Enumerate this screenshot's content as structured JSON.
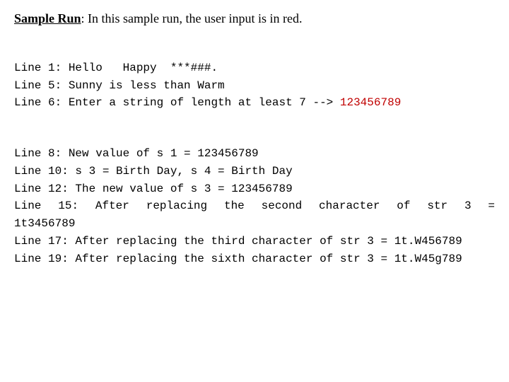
{
  "heading": {
    "label": "Sample Run",
    "rest": ": In this sample run, the user input is in red."
  },
  "lines": {
    "l1": "Line 1: Hello   Happy  ***###.",
    "l5": "Line 5: Sunny is less than Warm",
    "l6a": "Line 6: Enter a string of length at least 7 --> ",
    "l6b": "123456789",
    "l8": "Line 8: New value of s 1 = 123456789",
    "l10": "Line 10: s 3 = Birth Day, s 4 = Birth Day",
    "l12": "Line 12: The new value of s 3 = 123456789",
    "l15": "Line 15: After replacing the second character of str 3 = 1t3456789",
    "l15_words": [
      "Line",
      "15:",
      "After",
      "replacing",
      "the",
      "second",
      "character",
      "of",
      "str 3",
      "="
    ],
    "l15_tail": "1t3456789",
    "l17": "Line 17: After replacing the third character of str 3 = 1t.W456789",
    "l19": "Line 19: After replacing the sixth character of str 3 = 1t.W45g789"
  },
  "colors": {
    "user_input": "#c00000"
  }
}
